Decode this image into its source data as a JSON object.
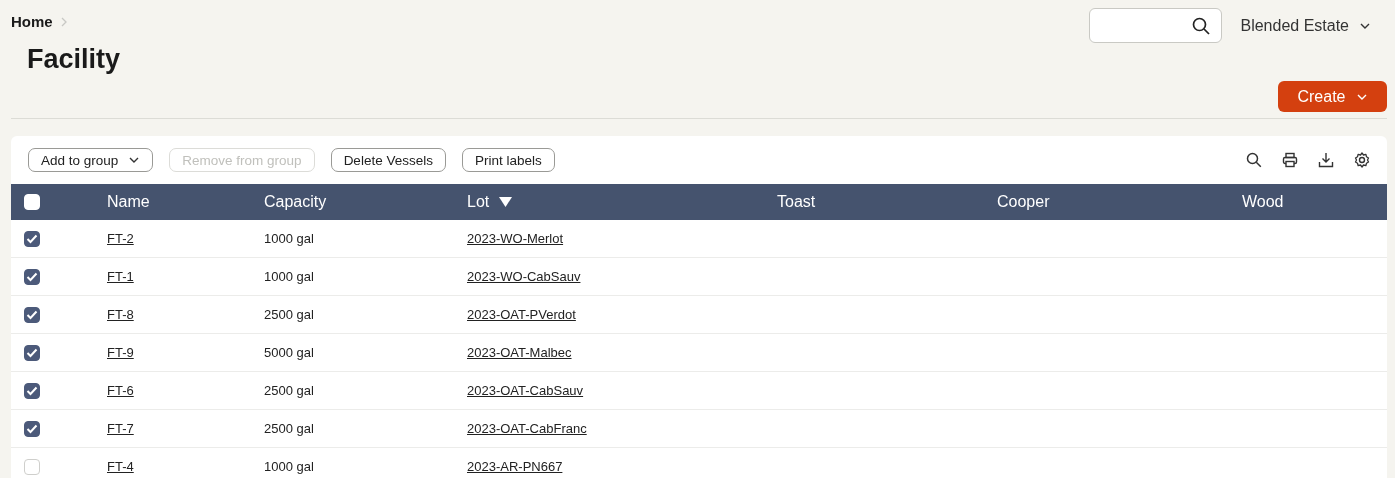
{
  "breadcrumb": [
    "Home"
  ],
  "title": "Facility",
  "account": {
    "label": "Blended Estate"
  },
  "create_button": {
    "label": "Create"
  },
  "toolbar": {
    "buttons": [
      {
        "label": "Add to group",
        "dropdown": true,
        "disabled": false
      },
      {
        "label": "Remove from group",
        "dropdown": false,
        "disabled": true
      },
      {
        "label": "Delete Vessels",
        "dropdown": false,
        "disabled": false
      },
      {
        "label": "Print labels",
        "dropdown": false,
        "disabled": false
      }
    ]
  },
  "table": {
    "select_all": {
      "checked": false
    },
    "columns": [
      {
        "label": "Name",
        "sorted": false
      },
      {
        "label": "Capacity",
        "sorted": false
      },
      {
        "label": "Lot",
        "sorted": true
      },
      {
        "label": "Toast",
        "sorted": false
      },
      {
        "label": "Cooper",
        "sorted": false
      },
      {
        "label": "Wood",
        "sorted": false
      }
    ],
    "rows": [
      {
        "checked": true,
        "name": "FT-2",
        "capacity": "1000 gal",
        "lot": "2023-WO-Merlot"
      },
      {
        "checked": true,
        "name": "FT-1",
        "capacity": "1000 gal",
        "lot": "2023-WO-CabSauv"
      },
      {
        "checked": true,
        "name": "FT-8",
        "capacity": "2500 gal",
        "lot": "2023-OAT-PVerdot"
      },
      {
        "checked": true,
        "name": "FT-9",
        "capacity": "5000 gal",
        "lot": "2023-OAT-Malbec"
      },
      {
        "checked": true,
        "name": "FT-6",
        "capacity": "2500 gal",
        "lot": "2023-OAT-CabSauv"
      },
      {
        "checked": true,
        "name": "FT-7",
        "capacity": "2500 gal",
        "lot": "2023-OAT-CabFranc"
      },
      {
        "checked": false,
        "name": "FT-4",
        "capacity": "1000 gal",
        "lot": "2023-AR-PN667"
      }
    ]
  }
}
